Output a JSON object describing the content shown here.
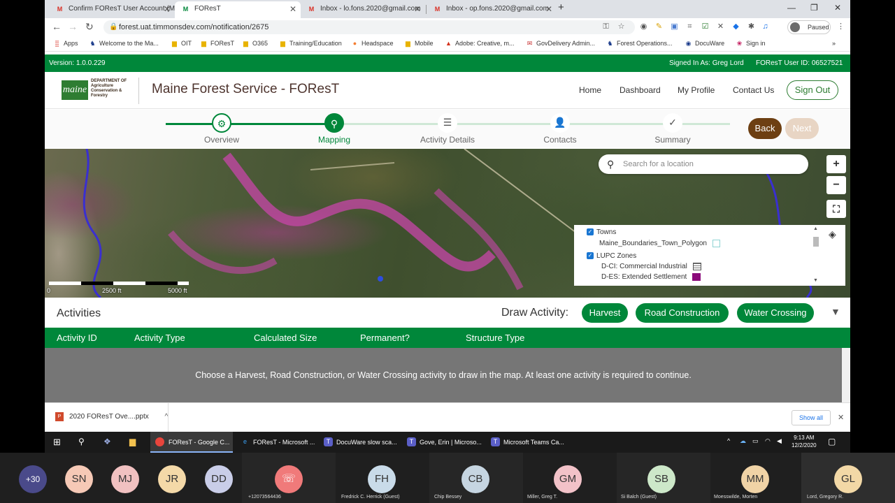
{
  "browser": {
    "tabs": [
      {
        "title": "Confirm FOResT User Account (M",
        "icon": "gmail-icon"
      },
      {
        "title": "FOResT",
        "icon": "forest-icon"
      },
      {
        "title": "Inbox - lo.fons.2020@gmail.com",
        "icon": "gmail-icon"
      },
      {
        "title": "Inbox - op.fons.2020@gmail.com",
        "icon": "gmail-icon"
      }
    ],
    "url": "forest.uat.timmonsdev.com/notification/2675",
    "profile_status": "Paused",
    "bookmarks": [
      "Apps",
      "Welcome to the Ma...",
      "OIT",
      "FOResT",
      "O365",
      "Training/Education",
      "Headspace",
      "Mobile",
      "Adobe: Creative, m...",
      "GovDelivery Admin...",
      "Forest Operations...",
      "DocuWare",
      "Sign in"
    ]
  },
  "site": {
    "version": "Version: 1.0.0.229",
    "signed_in": "Signed In As: Greg Lord",
    "user_id": "FOResT User ID: 06527521",
    "logo_text": "maine",
    "logo_sub": "DEPARTMENT OF Agriculture Conservation & Forestry",
    "title": "Maine Forest Service",
    "title_sub": "- FOResT",
    "nav": [
      "Home",
      "Dashboard",
      "My Profile",
      "Contact Us"
    ],
    "sign_out": "Sign Out"
  },
  "stepper": {
    "steps": [
      {
        "label": "Overview",
        "icon": "gear-icon",
        "state": "done"
      },
      {
        "label": "Mapping",
        "icon": "map-pin-icon",
        "state": "active"
      },
      {
        "label": "Activity Details",
        "icon": "list-icon",
        "state": "todo"
      },
      {
        "label": "Contacts",
        "icon": "person-icon",
        "state": "todo"
      },
      {
        "label": "Summary",
        "icon": "check-icon",
        "state": "todo"
      }
    ],
    "back": "Back",
    "next": "Next"
  },
  "map": {
    "search_placeholder": "Search for a location",
    "zoom_in": "+",
    "zoom_out": "−",
    "layers": {
      "towns": "Towns",
      "towns_layer": "Maine_Boundaries_Town_Polygon",
      "lupc": "LUPC Zones",
      "zone1": "D-CI: Commercial Industrial",
      "zone2": "D-ES: Extended Settlement"
    },
    "scale": [
      "0",
      "2500 ft",
      "5000 ft"
    ]
  },
  "activities": {
    "title": "Activities",
    "draw_label": "Draw Activity:",
    "buttons": [
      "Harvest",
      "Road Construction",
      "Water Crossing"
    ],
    "columns": [
      "Activity ID",
      "Activity Type",
      "Calculated Size",
      "Permanent?",
      "Structure Type"
    ],
    "empty_message": "Choose a Harvest, Road Construction, or Water Crossing activity to draw in the map. At least one activity is required to continue."
  },
  "downloads": {
    "file": "2020 FOResT Ove....pptx",
    "show_all": "Show all"
  },
  "taskbar": {
    "apps": [
      "FOResT - Google C...",
      "FOResT - Microsoft ...",
      "DocuWare slow sca...",
      "Gove, Erin | Microso...",
      "Microsoft Teams Ca..."
    ],
    "time": "9:13 AM",
    "date": "12/2/2020"
  },
  "meeting": {
    "more": "+30",
    "participants": [
      {
        "initials": "SN",
        "color": "#f6c9b6"
      },
      {
        "initials": "MJ",
        "color": "#f1c1c1"
      },
      {
        "initials": "JR",
        "color": "#f4d9a8"
      },
      {
        "initials": "DD",
        "color": "#c9cde8"
      }
    ],
    "tiles": [
      {
        "initials": "",
        "name": "+12073564436",
        "color": "#f07a7a"
      },
      {
        "initials": "FH",
        "name": "Fredrick C. Herrick (Guest)",
        "color": "#c9dbe9"
      },
      {
        "initials": "CB",
        "name": "Chip Bessey",
        "color": "#c6d5e1"
      },
      {
        "initials": "GM",
        "name": "Miller, Greg T.",
        "color": "#f2c2c8"
      },
      {
        "initials": "SB",
        "name": "Si Balch (Guest)",
        "color": "#cde8c9"
      },
      {
        "initials": "MM",
        "name": "Moesswilde, Morten",
        "color": "#f0d3a6"
      },
      {
        "initials": "GL",
        "name": "Lord, Gregory R.",
        "color": "#f2d8a6"
      }
    ]
  }
}
